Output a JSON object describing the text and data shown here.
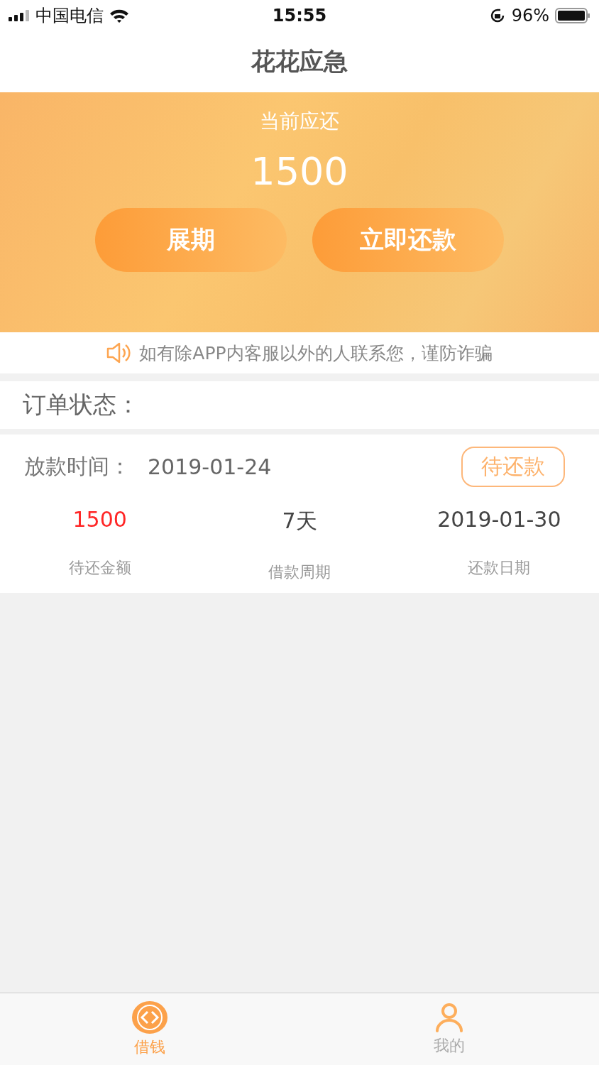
{
  "status_bar": {
    "carrier": "中国电信",
    "time": "15:55",
    "battery": "96%"
  },
  "nav": {
    "title": "花花应急"
  },
  "banner": {
    "caption": "当前应还",
    "amount": "1500",
    "buttons": [
      "展期",
      "立即还款"
    ]
  },
  "notice": "如有除APP内客服以外的人联系您，谨防诈骗",
  "order_status": {
    "label": "订单状态："
  },
  "loan": {
    "date_label": "放款时间：",
    "date": "2019-01-24",
    "status": "待还款",
    "stats": [
      {
        "value": "1500",
        "label": "待还金额",
        "color": "#ff2626"
      },
      {
        "value": "7天",
        "label": "借款周期",
        "color": "#444444"
      },
      {
        "value": "2019-01-30",
        "label": "还款日期",
        "color": "#444444"
      }
    ]
  },
  "tab_bar": [
    {
      "label": "借钱",
      "kind": "loan",
      "selected": true
    },
    {
      "label": "我的",
      "kind": "profile",
      "selected": false
    }
  ]
}
